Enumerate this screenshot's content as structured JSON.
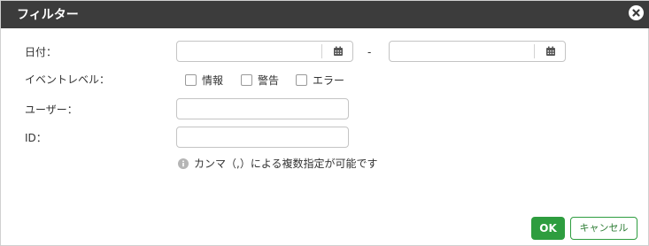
{
  "dialog": {
    "title": "フィルター",
    "close_icon": "close-circle-icon"
  },
  "fields": {
    "date_label": "日付：",
    "date_separator": "-",
    "date_from_value": "",
    "date_to_value": "",
    "calendar_icon": "calendar-icon",
    "event_level_label": "イベントレベル：",
    "event_levels": [
      {
        "label": "情報",
        "checked": false
      },
      {
        "label": "警告",
        "checked": false
      },
      {
        "label": "エラー",
        "checked": false
      }
    ],
    "user_label": "ユーザー：",
    "user_value": "",
    "id_label": "ID：",
    "id_value": "",
    "hint_icon": "info-icon",
    "hint": "カンマ（,）による複数指定が可能です"
  },
  "footer": {
    "ok_label": "OK",
    "cancel_label": "キャンセル"
  },
  "colors": {
    "titlebar": "#3c3c3c",
    "accent": "#2e9d3f"
  }
}
